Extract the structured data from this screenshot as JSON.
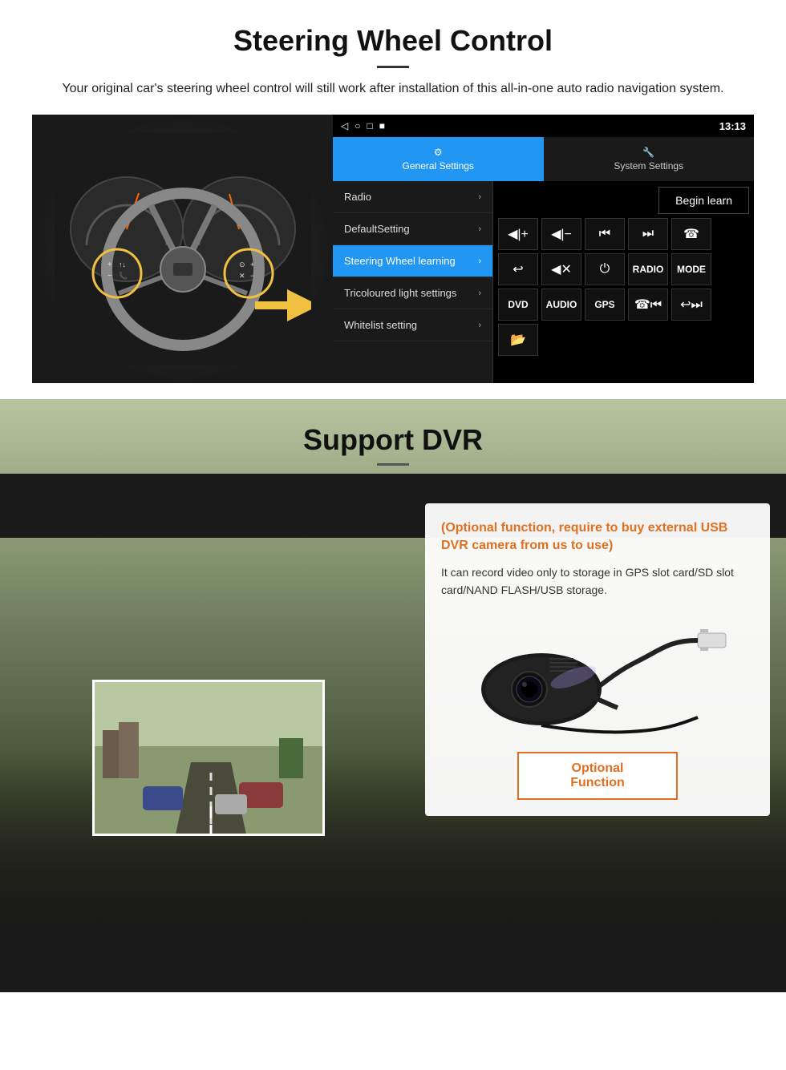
{
  "steering": {
    "title": "Steering Wheel Control",
    "subtitle": "Your original car's steering wheel control will still work after installation of this all-in-one auto radio navigation system.",
    "status_bar": {
      "time": "13:13",
      "icons": [
        "◁",
        "○",
        "□",
        "■"
      ]
    },
    "tabs": {
      "general": "General Settings",
      "system": "System Settings"
    },
    "menu_items": [
      {
        "label": "Radio",
        "active": false
      },
      {
        "label": "DefaultSetting",
        "active": false
      },
      {
        "label": "Steering Wheel learning",
        "active": true
      },
      {
        "label": "Tricoloured light settings",
        "active": false
      },
      {
        "label": "Whitelist setting",
        "active": false
      }
    ],
    "begin_learn_label": "Begin learn",
    "control_buttons": [
      [
        "vol+",
        "vol-",
        "⏮",
        "⏭",
        "☎"
      ],
      [
        "↩",
        "🔇",
        "⏻",
        "RADIO",
        "MODE"
      ],
      [
        "DVD",
        "AUDIO",
        "GPS",
        "⏮☎",
        "⏭↩"
      ]
    ]
  },
  "dvr": {
    "title": "Support DVR",
    "optional_title": "(Optional function, require to buy external USB DVR camera from us to use)",
    "description": "It can record video only to storage in GPS slot card/SD slot card/NAND FLASH/USB storage.",
    "optional_function_label": "Optional Function"
  }
}
